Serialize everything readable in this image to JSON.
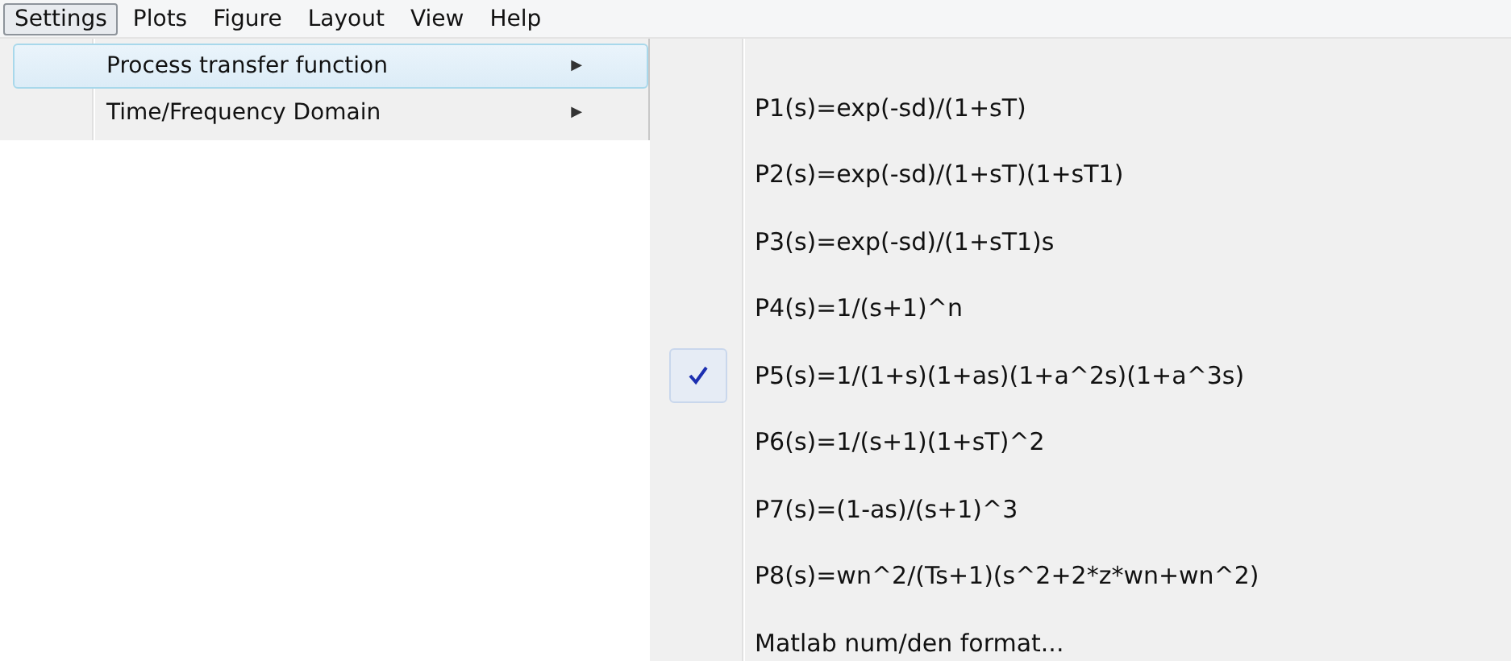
{
  "menu_bar": [
    {
      "label": "Settings",
      "selected": true
    },
    {
      "label": "Plots",
      "selected": false
    },
    {
      "label": "Figure",
      "selected": false
    },
    {
      "label": "Layout",
      "selected": false
    },
    {
      "label": "View",
      "selected": false
    },
    {
      "label": "Help",
      "selected": false
    }
  ],
  "settings_menu": [
    {
      "label": "Process transfer function",
      "arrow": "▶",
      "highlighted": true
    },
    {
      "label": "Time/Frequency Domain",
      "arrow": "▶",
      "highlighted": false
    }
  ],
  "submenu": [
    {
      "label": "P1(s)=exp(-sd)/(1+sT)",
      "checked": false
    },
    {
      "label": "P2(s)=exp(-sd)/(1+sT)(1+sT1)",
      "checked": false
    },
    {
      "label": "P3(s)=exp(-sd)/(1+sT1)s",
      "checked": false
    },
    {
      "label": "P4(s)=1/(s+1)^n",
      "checked": false
    },
    {
      "label": "P5(s)=1/(1+s)(1+as)(1+a^2s)(1+a^3s)",
      "checked": true
    },
    {
      "label": "P6(s)=1/(s+1)(1+sT)^2",
      "checked": false
    },
    {
      "label": "P7(s)=(1-as)/(s+1)^3",
      "checked": false
    },
    {
      "label": "P8(s)=wn^2/(Ts+1)(s^2+2*z*wn+wn^2)",
      "checked": false
    },
    {
      "label": "Matlab num/den format...",
      "checked": false
    }
  ]
}
